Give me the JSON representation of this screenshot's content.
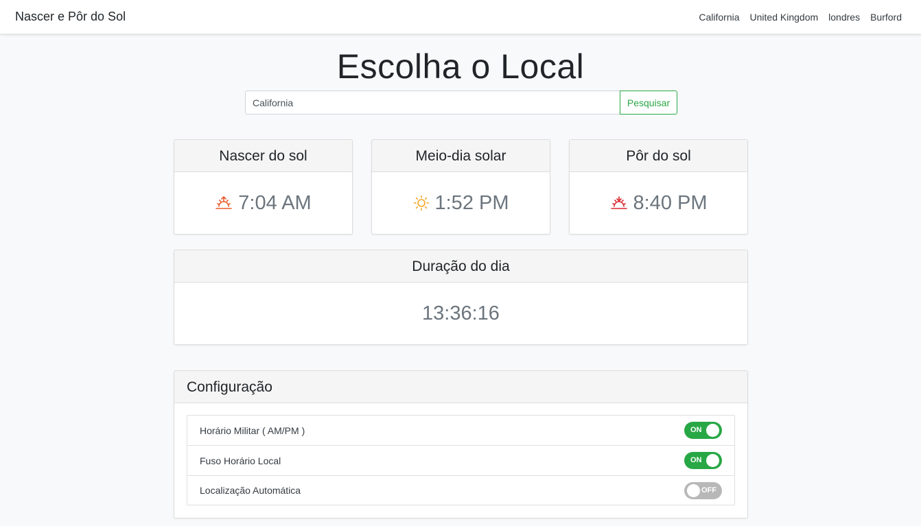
{
  "nav": {
    "brand": "Nascer e Pôr do Sol",
    "links": [
      "California",
      "United Kingdom",
      "londres",
      "Burford"
    ]
  },
  "heading": "Escolha o Local",
  "search": {
    "value": "California",
    "button": "Pesquisar"
  },
  "cards": {
    "sunrise": {
      "title": "Nascer do sol",
      "value": "7:04 AM",
      "icon": "sunrise-icon",
      "color": "#e8582a"
    },
    "noon": {
      "title": "Meio-dia solar",
      "value": "1:52 PM",
      "icon": "sun-icon",
      "color": "#f5a623"
    },
    "sunset": {
      "title": "Pôr do sol",
      "value": "8:40 PM",
      "icon": "sunset-icon",
      "color": "#d9262c"
    },
    "daylength": {
      "title": "Duração do dia",
      "value": "13:36:16"
    }
  },
  "config": {
    "title": "Configuração",
    "items": [
      {
        "label": "Horário Militar ( AM/PM )",
        "state": "ON"
      },
      {
        "label": "Fuso Horário Local",
        "state": "ON"
      },
      {
        "label": "Localização Automática",
        "state": "OFF"
      }
    ]
  },
  "colors": {
    "accent": "#28a745",
    "toggle_off": "#b8b8b8"
  }
}
